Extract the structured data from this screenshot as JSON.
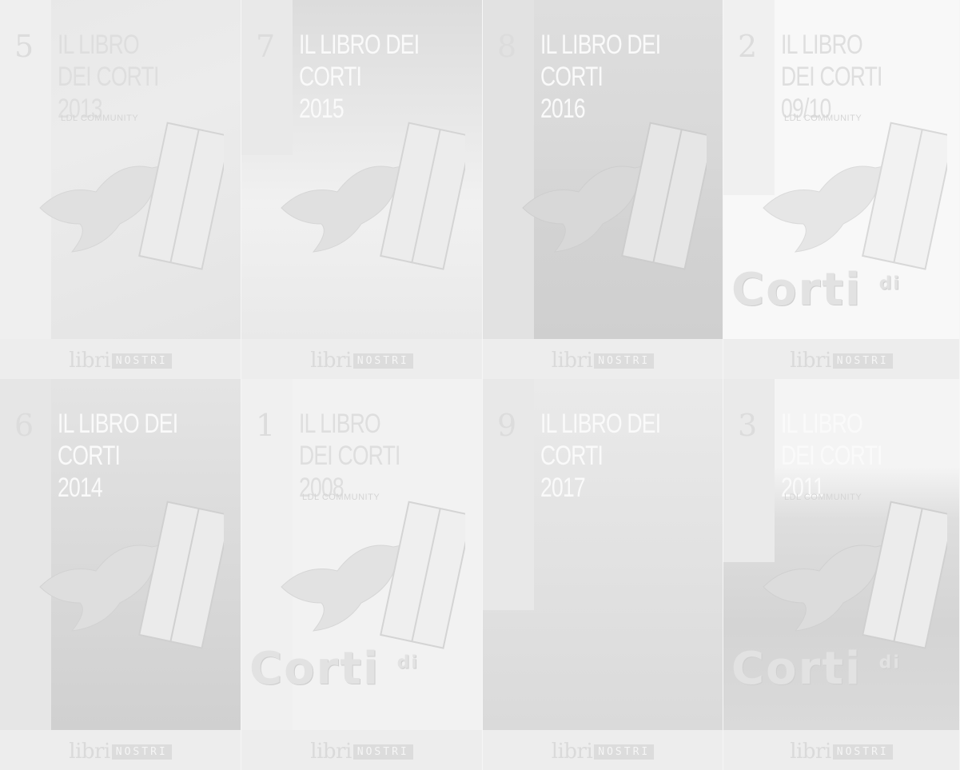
{
  "covers": [
    {
      "number": "5",
      "title": "IL LIBRO\nDEI CORTI 2013",
      "subtitle": "LDL COMMUNITY",
      "logo": "",
      "publisher_a": "libri",
      "publisher_b": "NOSTRI"
    },
    {
      "number": "7",
      "title": "IL LIBRO DEI CORTI\n2015",
      "subtitle": "",
      "logo": "",
      "publisher_a": "libri",
      "publisher_b": "NOSTRI"
    },
    {
      "number": "8",
      "title": "IL LIBRO DEI CORTI\n2016",
      "subtitle": "",
      "logo": "",
      "publisher_a": "libri",
      "publisher_b": "NOSTRI"
    },
    {
      "number": "2",
      "title": "IL LIBRO\nDEI CORTI 09/10",
      "subtitle": "LDL COMMUNITY",
      "logo": "Corti",
      "logo_di": "di",
      "publisher_a": "libri",
      "publisher_b": "NOSTRI"
    },
    {
      "number": "6",
      "title": "IL LIBRO DEI CORTI\n2014",
      "subtitle": "",
      "logo": "",
      "publisher_a": "libri",
      "publisher_b": "NOSTRI"
    },
    {
      "number": "1",
      "title": "IL LIBRO\nDEI CORTI 2008",
      "subtitle": "LDL COMMUNITY",
      "logo": "Corti",
      "logo_di": "di",
      "publisher_a": "libri",
      "publisher_b": "NOSTRI"
    },
    {
      "number": "9",
      "title": "IL LIBRO DEI CORTI\n2017",
      "subtitle": "",
      "logo": "",
      "publisher_a": "libri",
      "publisher_b": "NOSTRI"
    },
    {
      "number": "3",
      "title": "IL LIBRO\nDEI CORTI 2011",
      "subtitle": "LDL COMMUNITY",
      "logo": "Corti",
      "logo_di": "di",
      "publisher_a": "libri",
      "publisher_b": "NOSTRI"
    }
  ],
  "icons": {
    "bird": "hummingbird-with-book-icon"
  }
}
